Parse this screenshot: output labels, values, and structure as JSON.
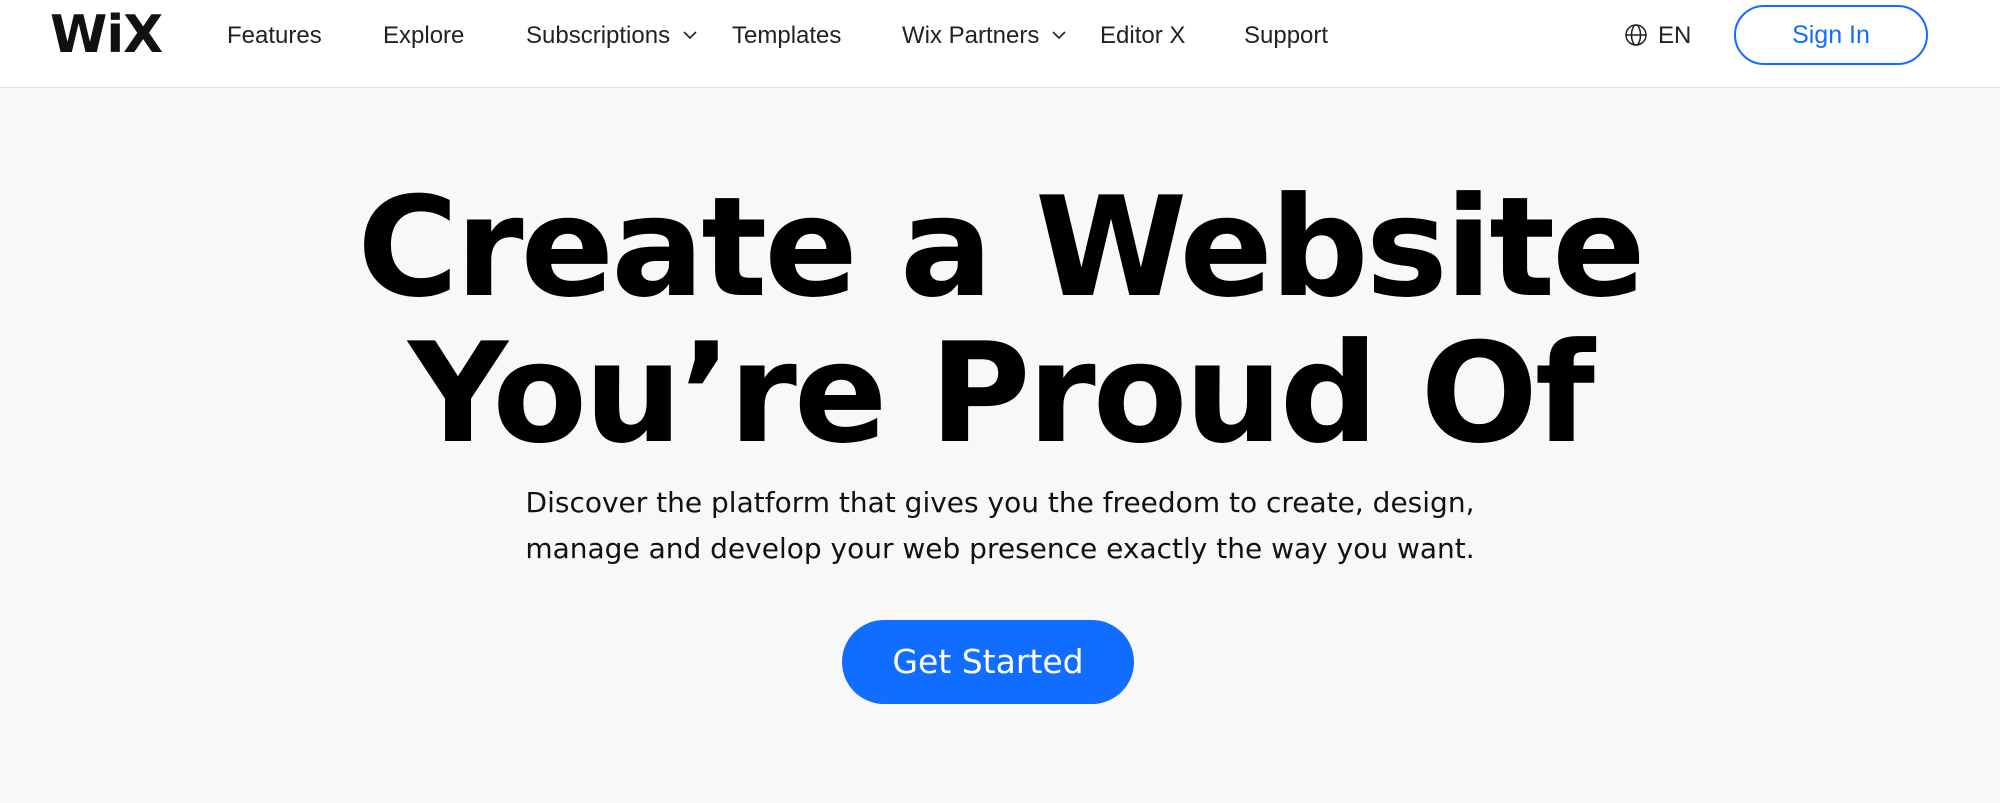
{
  "header": {
    "logo": "WiX",
    "nav": [
      {
        "label": "Features",
        "has_dropdown": false
      },
      {
        "label": "Explore",
        "has_dropdown": false
      },
      {
        "label": "Subscriptions",
        "has_dropdown": true
      },
      {
        "label": "Templates",
        "has_dropdown": false
      },
      {
        "label": "Wix Partners",
        "has_dropdown": true
      },
      {
        "label": "Editor X",
        "has_dropdown": false
      },
      {
        "label": "Support",
        "has_dropdown": false
      }
    ],
    "language": "EN",
    "sign_in": "Sign In"
  },
  "hero": {
    "headline_line1": "Create a Website",
    "headline_line2": "You’re Proud Of",
    "subtitle_line1": "Discover the platform that gives you the freedom to create, design,",
    "subtitle_line2": "manage and develop your web presence exactly the way you want.",
    "cta": "Get Started"
  },
  "colors": {
    "accent": "#116dff",
    "background": "#f8f8f8",
    "header_background": "#ffffff"
  },
  "icons": {
    "language": "globe-icon",
    "dropdown": "chevron-down-icon"
  }
}
